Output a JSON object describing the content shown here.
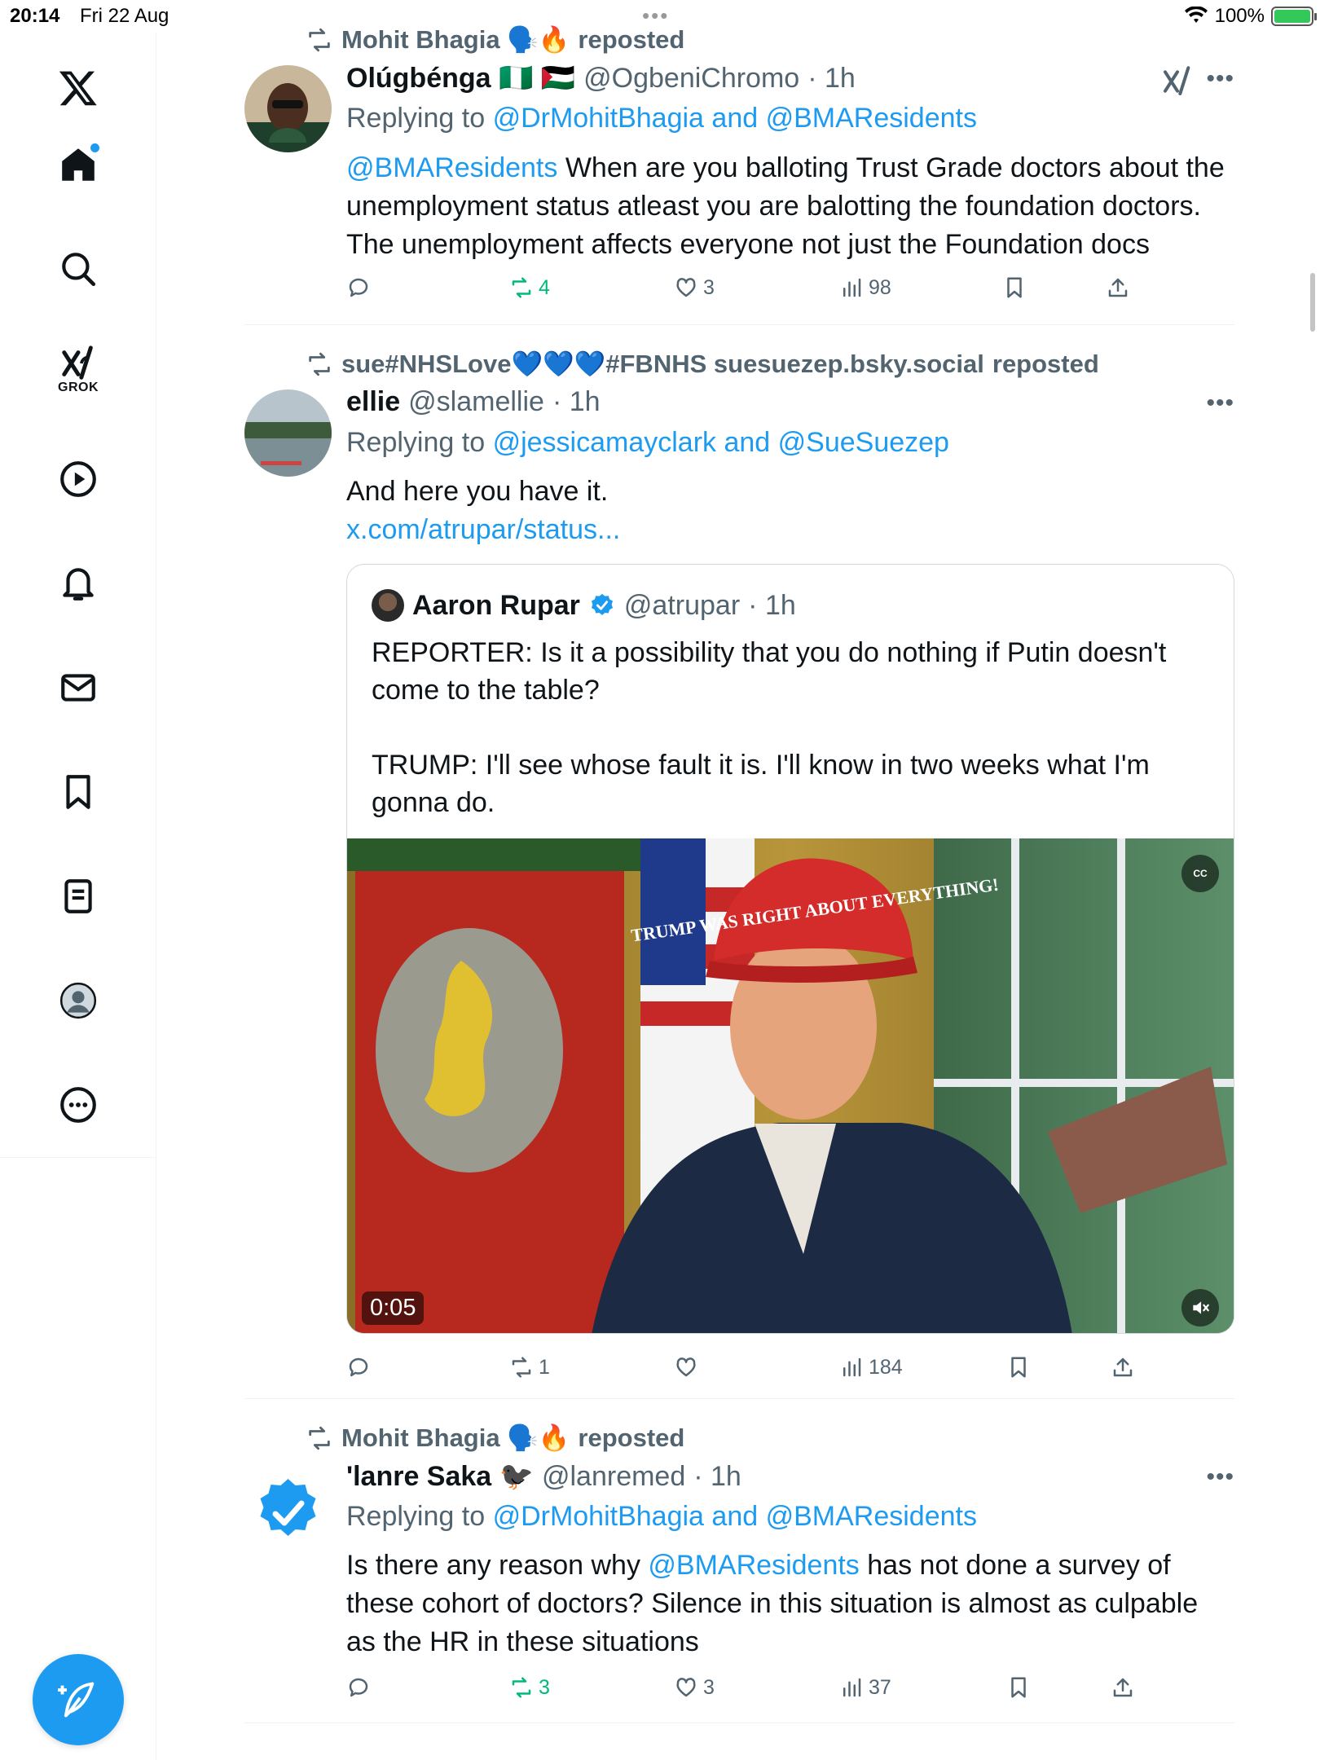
{
  "status": {
    "time": "20:14",
    "date": "Fri 22 Aug",
    "battery": "100%",
    "battery_level": 1.0
  },
  "sidebar": {
    "items": [
      {
        "icon": "x-logo-icon"
      },
      {
        "icon": "home-icon",
        "has_notification": true
      },
      {
        "icon": "search-icon"
      },
      {
        "icon": "grok-icon",
        "label": "GROK"
      },
      {
        "icon": "play-icon"
      },
      {
        "icon": "bell-icon"
      },
      {
        "icon": "mail-icon"
      },
      {
        "icon": "bookmark-icon"
      },
      {
        "icon": "list-icon"
      },
      {
        "icon": "profile-icon"
      },
      {
        "icon": "more-icon"
      }
    ],
    "compose_icon": "feather-plus-icon"
  },
  "tweets": [
    {
      "repost_by": "Mohit Bhagia 🗣️🔥",
      "repost_suffix": "reposted",
      "name": "Olúgbénga 🇳🇬 🇵🇸",
      "handle": "@OgbeniChromo",
      "time": "· 1h",
      "reply_prefix": "Replying to",
      "reply_to": "@DrMohitBhagia and @BMAResidents",
      "mention": "@BMAResidents",
      "text": "When are you balloting Trust Grade doctors about the unemployment status atleast you are balotting the foundation doctors. The unemployment affects everyone not just the Foundation docs",
      "reposts": "4",
      "likes": "3",
      "views": "98"
    },
    {
      "repost_by": "sue#NHSLove💙💙💙#FBNHS suesuezep.bsky.social",
      "repost_suffix": "reposted",
      "name": "ellie",
      "handle": "@slamellie",
      "time": "· 1h",
      "reply_prefix": "Replying to",
      "reply_to": "@jessicamayclark and @SueSuezep",
      "text": "And here you have it.",
      "link": "x.com/atrupar/status...",
      "quote": {
        "name": "Aaron Rupar",
        "handle": "@atrupar",
        "time": "· 1h",
        "text_1": "REPORTER: Is it a possibility that you do nothing if Putin doesn't come to the table?",
        "text_2": "TRUMP: I'll see whose fault it is. I'll know in two weeks what I'm gonna do.",
        "video_time": "0:05",
        "cc": "CC",
        "hat_text": "TRUMP WAS RIGHT ABOUT EVERYTHING!"
      },
      "reposts": "1",
      "views": "184"
    },
    {
      "repost_by": "Mohit Bhagia 🗣️🔥",
      "repost_suffix": "reposted",
      "name": "'lanre Saka 🐦‍⬛",
      "handle": "@lanremed",
      "time": "· 1h",
      "reply_prefix": "Replying to",
      "reply_to": "@DrMohitBhagia and @BMAResidents",
      "text_before": "Is there any reason why",
      "mention": "@BMAResidents",
      "text_after": "has not done a survey of these cohort of doctors? Silence in this situation is almost as culpable as the HR in these situations",
      "reposts": "3",
      "likes": "3",
      "views": "37"
    }
  ],
  "colors": {
    "accent": "#1d9bf0",
    "repost_green": "#00ba7c",
    "text_secondary": "#536471"
  }
}
